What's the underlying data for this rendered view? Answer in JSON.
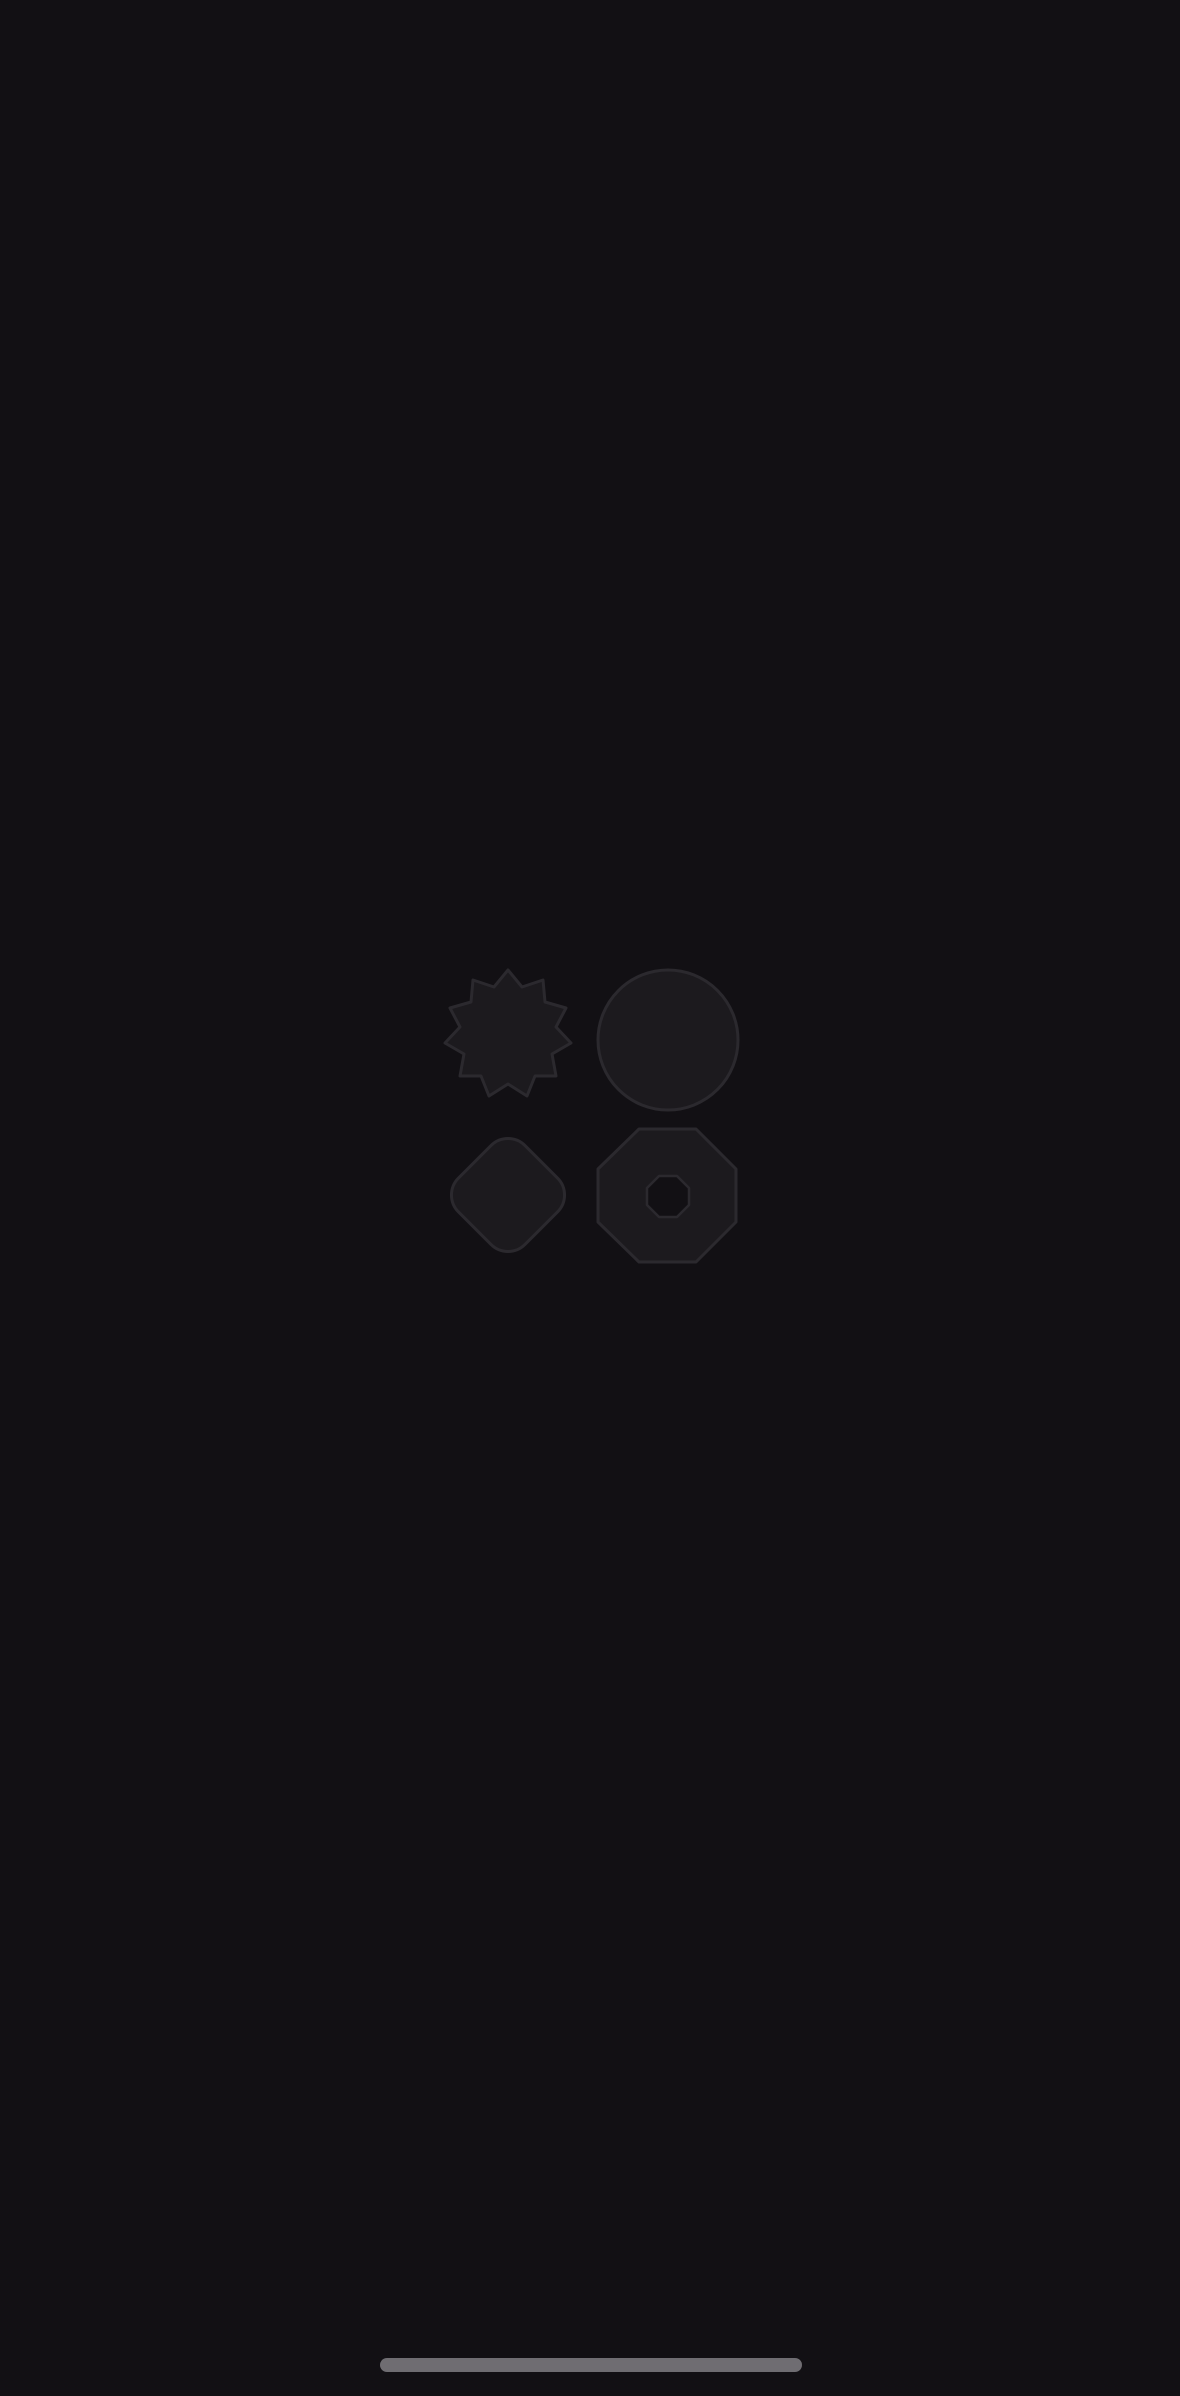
{
  "screen": {
    "type": "splash",
    "background_color": "#121014"
  },
  "logo": {
    "icon_names": [
      "star-burst-icon",
      "circle-icon",
      "rounded-diamond-icon",
      "octagon-ring-icon"
    ],
    "fill_color": "#1c1a1e",
    "stroke_color": "#2b292e"
  },
  "home_indicator": {
    "color": "#6f6d72"
  }
}
